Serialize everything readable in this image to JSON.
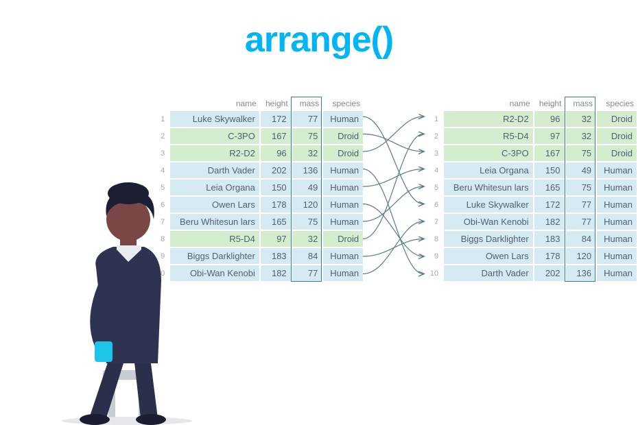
{
  "title": "arrange()",
  "columns": {
    "name": "name",
    "height": "height",
    "mass": "mass",
    "species": "species"
  },
  "left_rows": [
    {
      "idx": "1",
      "name": "Luke Skywalker",
      "height": "172",
      "mass": "77",
      "species": "Human",
      "color": "blue"
    },
    {
      "idx": "2",
      "name": "C-3PO",
      "height": "167",
      "mass": "75",
      "species": "Droid",
      "color": "green"
    },
    {
      "idx": "3",
      "name": "R2-D2",
      "height": "96",
      "mass": "32",
      "species": "Droid",
      "color": "green"
    },
    {
      "idx": "4",
      "name": "Darth Vader",
      "height": "202",
      "mass": "136",
      "species": "Human",
      "color": "blue"
    },
    {
      "idx": "5",
      "name": "Leia Organa",
      "height": "150",
      "mass": "49",
      "species": "Human",
      "color": "blue"
    },
    {
      "idx": "6",
      "name": "Owen Lars",
      "height": "178",
      "mass": "120",
      "species": "Human",
      "color": "blue"
    },
    {
      "idx": "7",
      "name": "Beru Whitesun lars",
      "height": "165",
      "mass": "75",
      "species": "Human",
      "color": "blue"
    },
    {
      "idx": "8",
      "name": "R5-D4",
      "height": "97",
      "mass": "32",
      "species": "Droid",
      "color": "green"
    },
    {
      "idx": "9",
      "name": "Biggs Darklighter",
      "height": "183",
      "mass": "84",
      "species": "Human",
      "color": "blue"
    },
    {
      "idx": "10",
      "name": "Obi-Wan Kenobi",
      "height": "182",
      "mass": "77",
      "species": "Human",
      "color": "blue"
    }
  ],
  "right_rows": [
    {
      "idx": "1",
      "name": "R2-D2",
      "height": "96",
      "mass": "32",
      "species": "Droid",
      "color": "green"
    },
    {
      "idx": "2",
      "name": "R5-D4",
      "height": "97",
      "mass": "32",
      "species": "Droid",
      "color": "green"
    },
    {
      "idx": "3",
      "name": "C-3PO",
      "height": "167",
      "mass": "75",
      "species": "Droid",
      "color": "green"
    },
    {
      "idx": "4",
      "name": "Leia Organa",
      "height": "150",
      "mass": "49",
      "species": "Human",
      "color": "blue"
    },
    {
      "idx": "5",
      "name": "Beru Whitesun lars",
      "height": "165",
      "mass": "75",
      "species": "Human",
      "color": "blue"
    },
    {
      "idx": "6",
      "name": "Luke Skywalker",
      "height": "172",
      "mass": "77",
      "species": "Human",
      "color": "blue"
    },
    {
      "idx": "7",
      "name": "Obi-Wan Kenobi",
      "height": "182",
      "mass": "77",
      "species": "Human",
      "color": "blue"
    },
    {
      "idx": "8",
      "name": "Biggs Darklighter",
      "height": "183",
      "mass": "84",
      "species": "Human",
      "color": "blue"
    },
    {
      "idx": "9",
      "name": "Owen Lars",
      "height": "178",
      "mass": "120",
      "species": "Human",
      "color": "blue"
    },
    {
      "idx": "10",
      "name": "Darth Vader",
      "height": "202",
      "mass": "136",
      "species": "Human",
      "color": "blue"
    }
  ],
  "mapping": [
    {
      "from": 0,
      "to": 5
    },
    {
      "from": 1,
      "to": 2
    },
    {
      "from": 2,
      "to": 0
    },
    {
      "from": 3,
      "to": 9
    },
    {
      "from": 4,
      "to": 3
    },
    {
      "from": 5,
      "to": 8
    },
    {
      "from": 6,
      "to": 4
    },
    {
      "from": 7,
      "to": 1
    },
    {
      "from": 8,
      "to": 7
    },
    {
      "from": 9,
      "to": 6
    }
  ]
}
